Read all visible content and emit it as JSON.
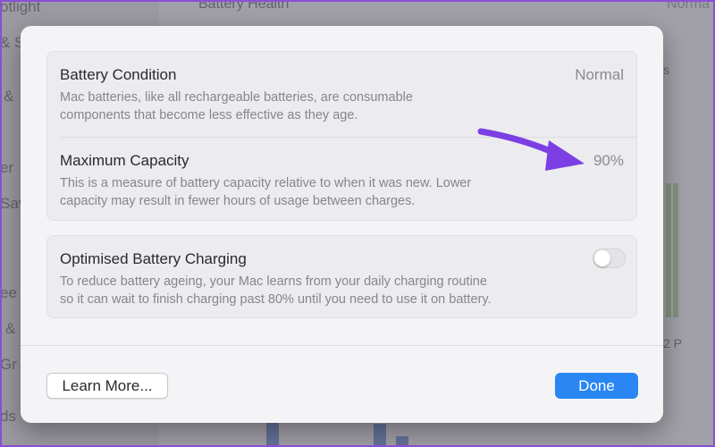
{
  "background": {
    "sidebar_fragments": [
      "otlight",
      "& Sav",
      "&",
      "er",
      "Sav",
      "ee",
      "&",
      "Gr",
      "ds"
    ],
    "title": "Battery Health",
    "status": "Norma",
    "chart_label_s": "s",
    "chart_label_time": "2 P"
  },
  "dialog": {
    "battery_condition": {
      "title": "Battery Condition",
      "value": "Normal",
      "description_line1": "Mac batteries, like all rechargeable batteries, are consumable",
      "description_line2": "components that become less effective as they age."
    },
    "maximum_capacity": {
      "title": "Maximum Capacity",
      "value": "90%",
      "description_line1": "This is a measure of battery capacity relative to when it was new. Lower",
      "description_line2": "capacity may result in fewer hours of usage between charges."
    },
    "optimised_charging": {
      "title": "Optimised Battery Charging",
      "description_line1": "To reduce battery ageing, your Mac learns from your daily charging routine",
      "description_line2": "so it can wait to finish charging past 80% until you need to use it on battery.",
      "enabled": false
    },
    "buttons": {
      "learn_more": "Learn More...",
      "done": "Done"
    }
  },
  "colors": {
    "accent": "#2a86f2",
    "annotation_arrow": "#7b3fe4"
  }
}
